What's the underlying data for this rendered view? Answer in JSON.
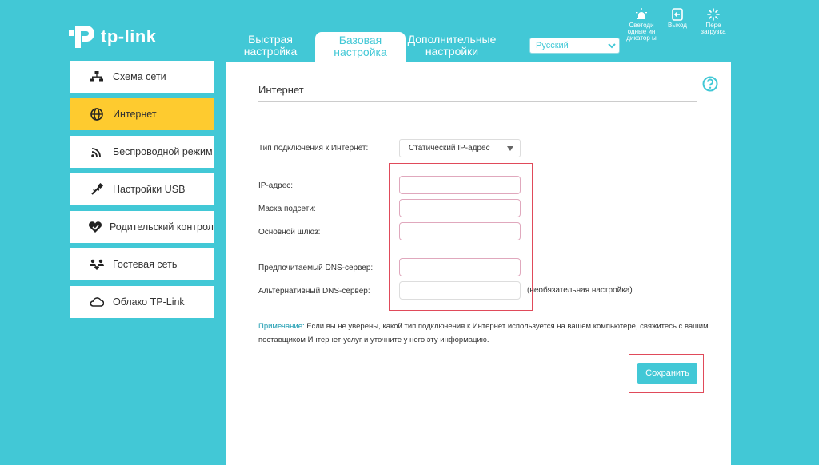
{
  "brand": {
    "name": "tp-link"
  },
  "tabs": [
    {
      "label_line1": "Быстрая",
      "label_line2": "настройка"
    },
    {
      "label_line1": "Базовая",
      "label_line2": "настройка"
    },
    {
      "label_line1": "Дополнительные",
      "label_line2": "настройки"
    }
  ],
  "language": {
    "selected": "Русский"
  },
  "top_icons": [
    {
      "label": "Светоди одные ин дикатор ы",
      "icon": "led-icon"
    },
    {
      "label": "Выход",
      "icon": "logout-icon"
    },
    {
      "label": "Пере загрузка",
      "icon": "reboot-icon"
    }
  ],
  "sidebar": {
    "items": [
      {
        "label": "Схема сети",
        "icon": "network-map-icon"
      },
      {
        "label": "Интернет",
        "icon": "globe-icon",
        "active": true
      },
      {
        "label": "Беспроводной режим",
        "icon": "wireless-icon"
      },
      {
        "label": "Настройки USB",
        "icon": "usb-icon"
      },
      {
        "label": "Родительский контроль",
        "icon": "parental-control-icon"
      },
      {
        "label": "Гостевая сеть",
        "icon": "guest-network-icon"
      },
      {
        "label": "Облако TP-Link",
        "icon": "cloud-icon"
      }
    ]
  },
  "main": {
    "title": "Интернет",
    "connection_type_label": "Тип подключения к Интернет:",
    "connection_type_value": "Статический IP-адрес",
    "fields": {
      "ip_label": "IP-адрес:",
      "ip_value": "",
      "mask_label": "Маска подсети:",
      "mask_value": "",
      "gateway_label": "Основной шлюз:",
      "gateway_value": "",
      "dns1_label": "Предпочитаемый DNS-сервер:",
      "dns1_value": "",
      "dns2_label": "Альтернативный DNS-сервер:",
      "dns2_value": "",
      "optional_text": "(необязательная настройка)"
    },
    "note_label": "Примечание:",
    "note_text": "Если вы не уверены, какой тип подключения к Интернет используется на вашем компьютере, свяжитесь с вашим поставщиком Интернет-услуг и уточните у него эту информацию.",
    "save_label": "Сохранить"
  },
  "colors": {
    "accent": "#42c8d6",
    "active_item": "#fecb2f",
    "highlight": "#e04a5a"
  }
}
